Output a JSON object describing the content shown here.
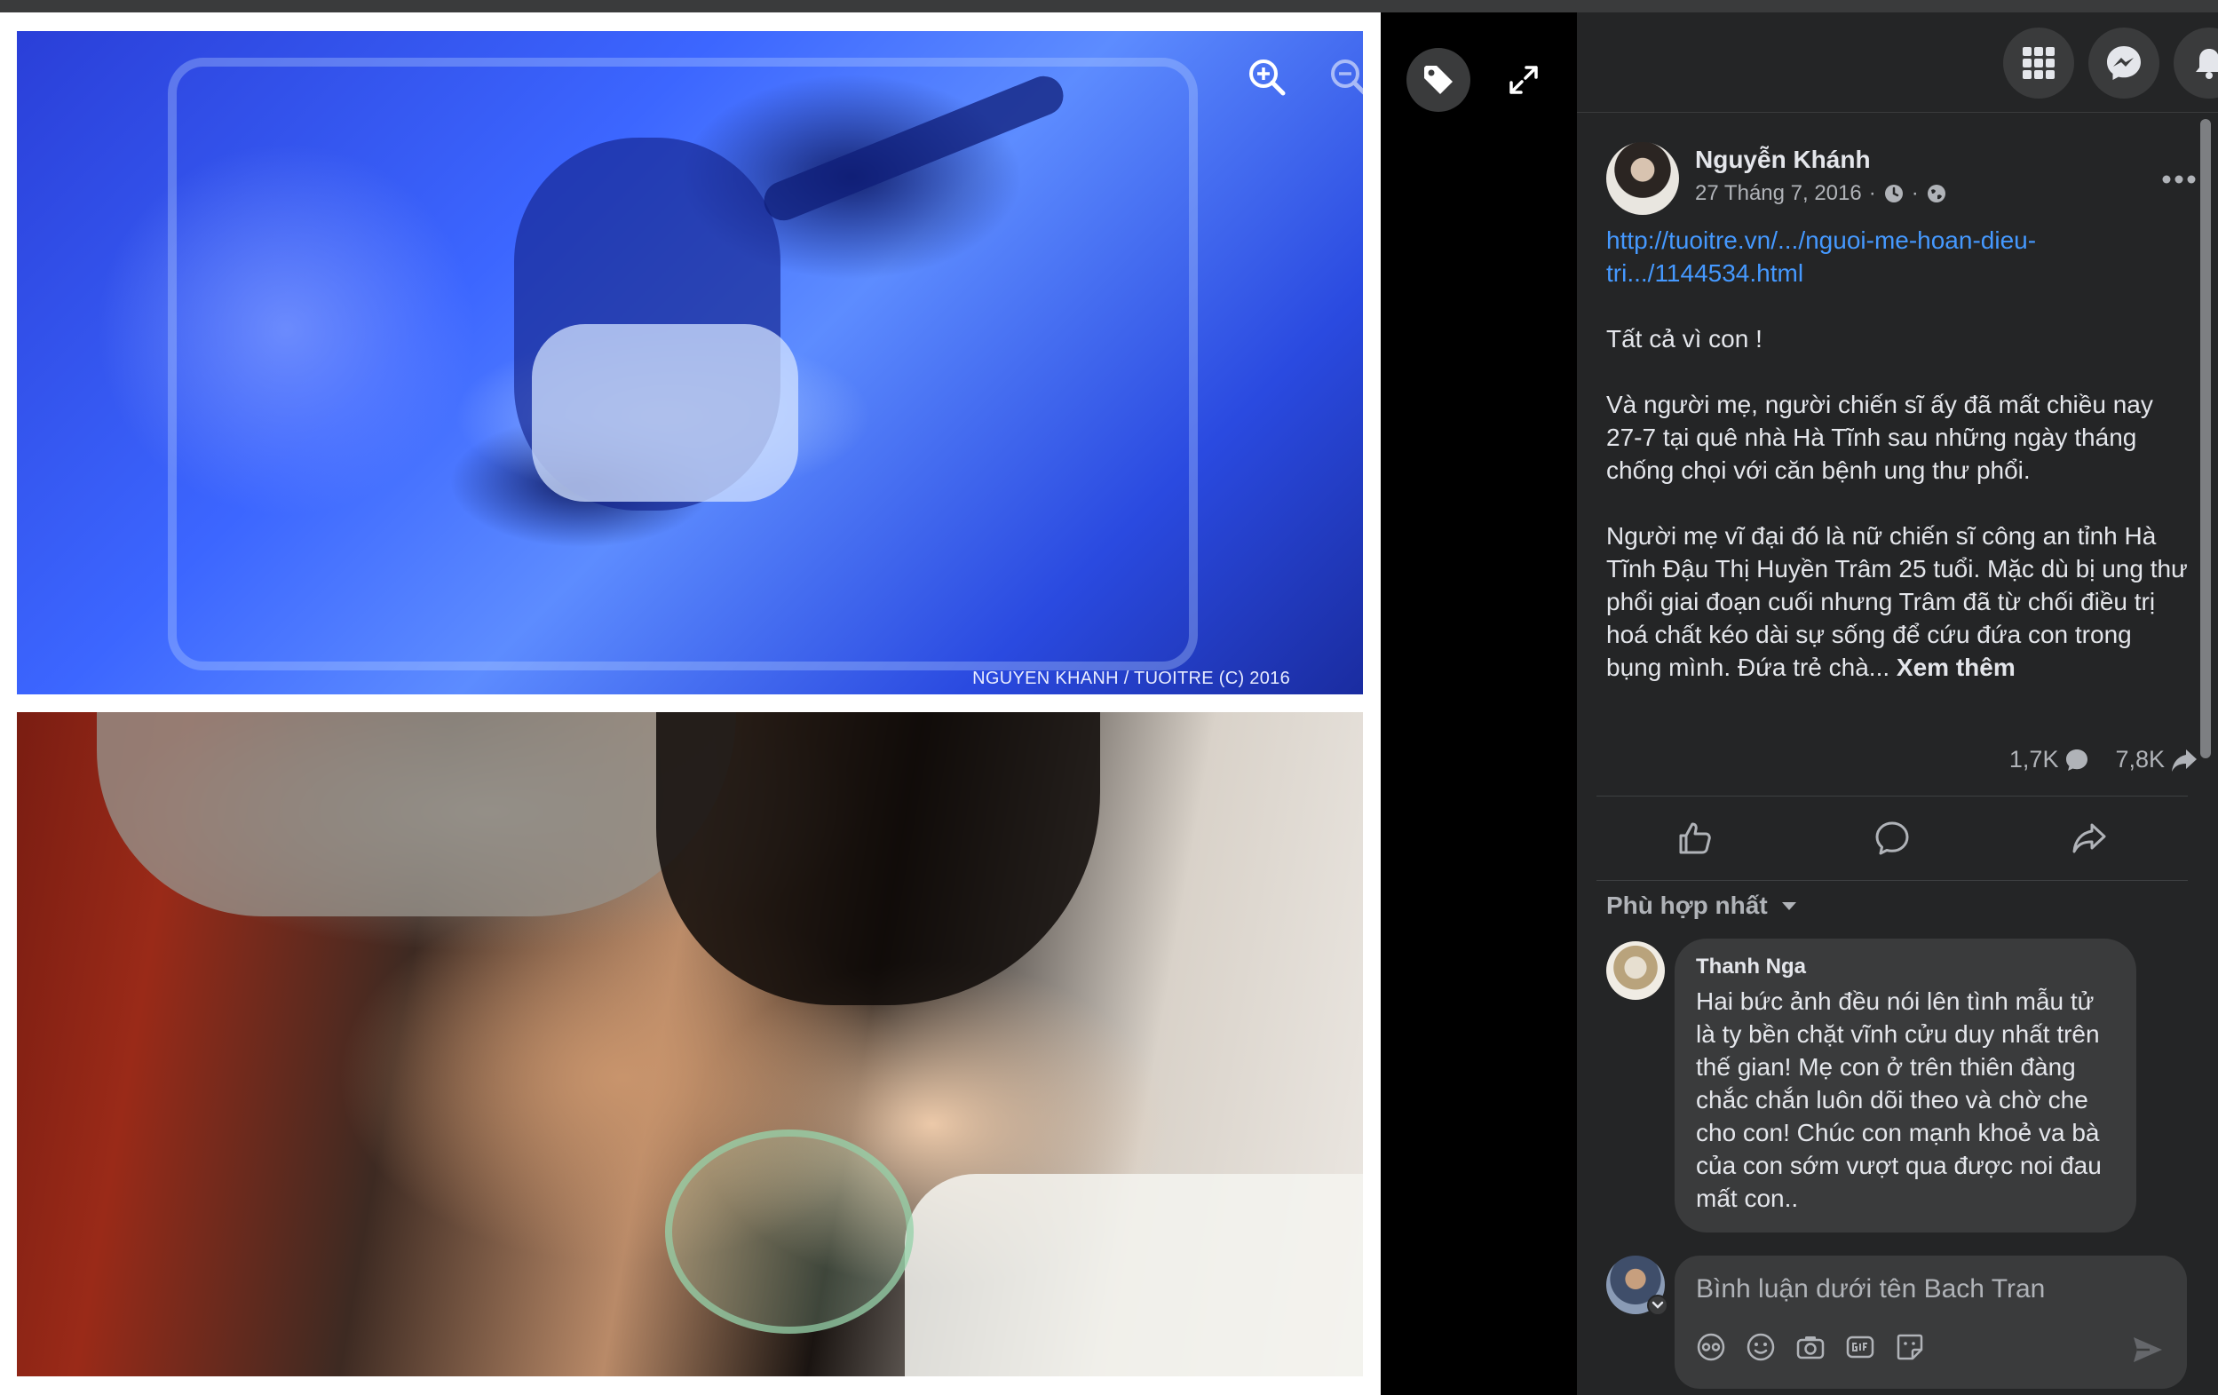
{
  "viewer": {
    "photo_credit": "NGUYEN KHANH / TUOITRE (C) 2016",
    "zoom_in_icon": "zoom-in-icon",
    "zoom_out_icon": "zoom-out-icon",
    "tag_icon": "tag-icon",
    "fullscreen_icon": "fullscreen-icon"
  },
  "header": {
    "menu_icon": "grid-menu-icon",
    "messenger_icon": "messenger-icon",
    "notifications_icon": "bell-icon"
  },
  "post": {
    "author": "Nguyễn Khánh",
    "date": "27 Tháng 7, 2016",
    "separator": "·",
    "link": "http://tuoitre.vn/.../nguoi-me-hoan-dieu-tri.../1144534.html",
    "paragraphs": [
      "Tất cả vì con !",
      "Và người mẹ, người chiến sĩ ấy đã mất chiều nay 27-7 tại quê nhà Hà Tĩnh sau những ngày tháng chống chọi với căn bệnh ung thư phổi."
    ],
    "last_paragraph": "Người mẹ vĩ đại đó là nữ chiến sĩ công an tỉnh Hà Tĩnh Đậu Thị Huyền Trâm 25 tuổi. Mặc dù bị ung thư phổi giai đoạn cuối nhưng Trâm đã từ chối điều trị hoá chất kéo dài sự sống để cứu đứa con trong bụng mình. Đứa trẻ chà...",
    "see_more": "Xem thêm",
    "comment_count": "1,7K",
    "share_count": "7,8K"
  },
  "actions": {
    "like_icon": "thumbs-up-icon",
    "comment_icon": "comment-icon",
    "share_icon": "share-icon"
  },
  "comments": {
    "sort_label": "Phù hợp nhất",
    "items": [
      {
        "name": "Thanh Nga",
        "text": "Hai bức ảnh đều nói lên tình mẫu tử là ty bền chặt vĩnh cửu duy nhất trên thế gian! Mẹ con ở trên thiên đàng chắc chắn luôn dõi theo và chờ che cho con! Chúc con mạnh khoẻ va bà của con sớm vượt qua được noi đau mất con.."
      }
    ],
    "composer_placeholder": "Bình luận dưới tên Bach Tran",
    "tools": [
      "avatar-sticker-icon",
      "emoji-icon",
      "camera-icon",
      "gif-icon",
      "sticker-icon"
    ],
    "send_icon": "send-icon"
  },
  "colors": {
    "panel_bg": "#242526",
    "bubble_bg": "#3a3b3c",
    "link": "#4599ff",
    "text_primary": "#e4e6eb",
    "text_secondary": "#b0b3b8"
  }
}
